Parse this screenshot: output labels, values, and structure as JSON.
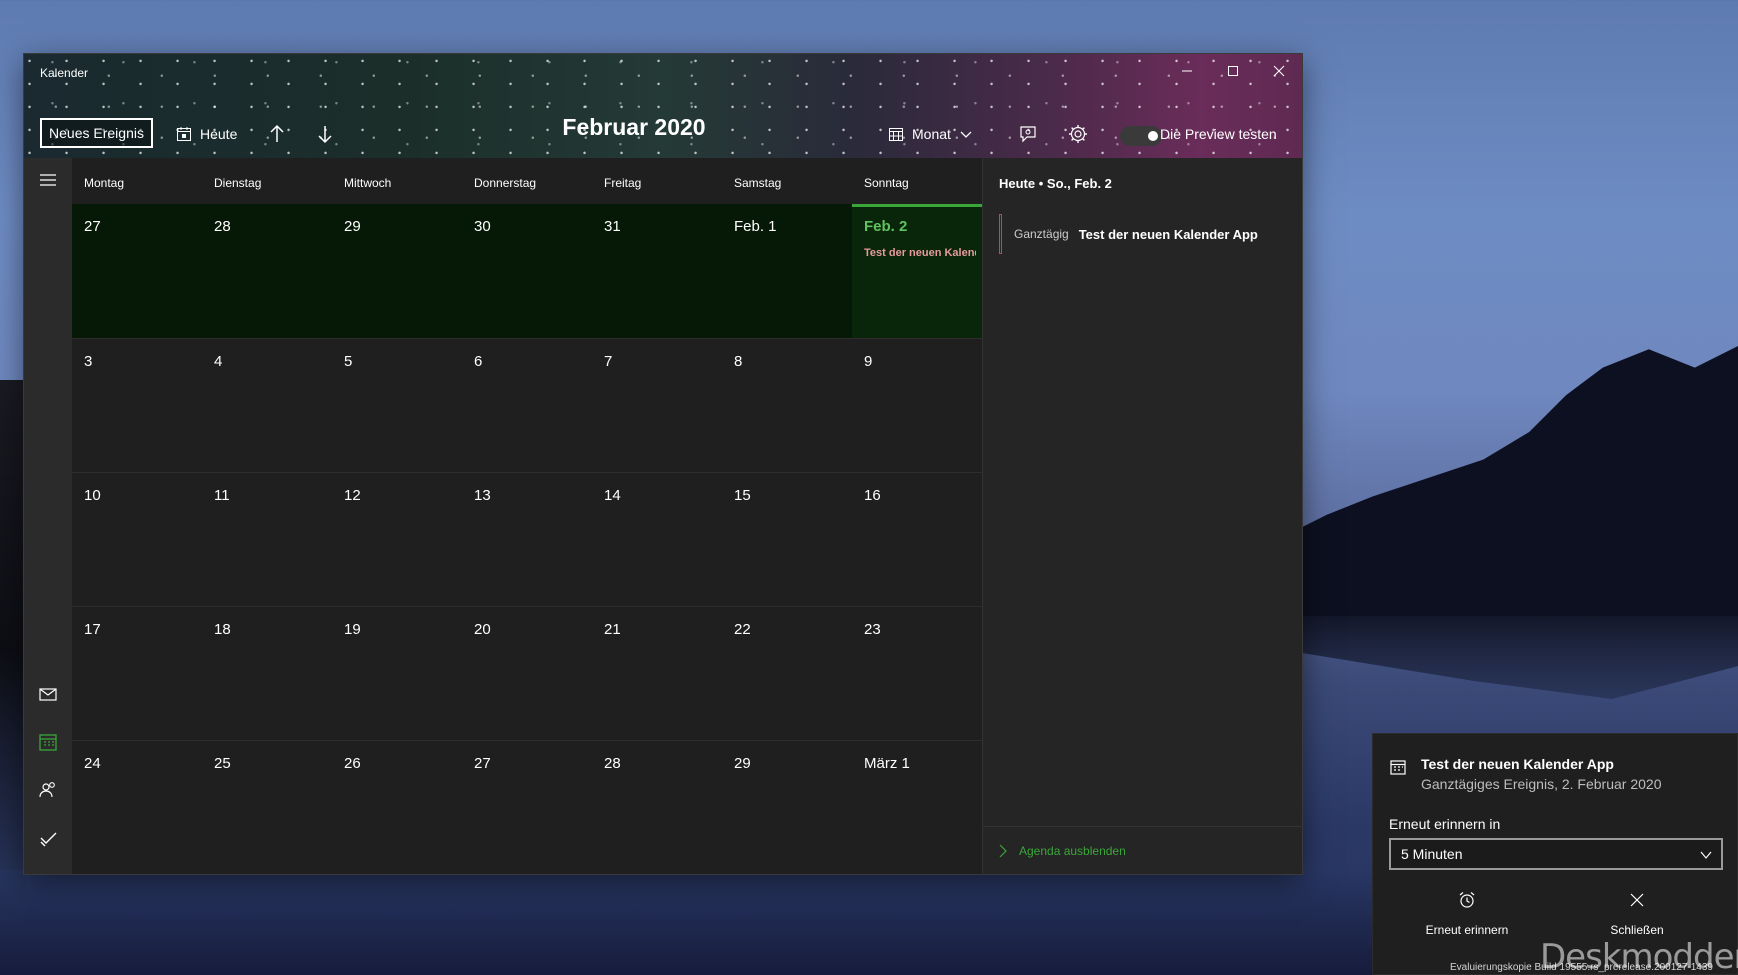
{
  "window": {
    "title": "Kalender"
  },
  "toolbar": {
    "new_event": "Neues Ereignis",
    "today": "Heute",
    "month_title": "Februar 2020",
    "view": "Monat",
    "preview_label": "Die Preview testen"
  },
  "day_headers": [
    "Montag",
    "Dienstag",
    "Mittwoch",
    "Donnerstag",
    "Freitag",
    "Samstag",
    "Sonntag"
  ],
  "weeks": [
    [
      "27",
      "28",
      "29",
      "30",
      "31",
      "Feb. 1",
      "Feb. 2"
    ],
    [
      "3",
      "4",
      "5",
      "6",
      "7",
      "8",
      "9"
    ],
    [
      "10",
      "11",
      "12",
      "13",
      "14",
      "15",
      "16"
    ],
    [
      "17",
      "18",
      "19",
      "20",
      "21",
      "22",
      "23"
    ],
    [
      "24",
      "25",
      "26",
      "27",
      "28",
      "29",
      "März 1"
    ]
  ],
  "today_event": "Test der neuen Kalender App",
  "agenda": {
    "header": "Heute • So., Feb. 2",
    "event_time": "Ganztägig",
    "event_title": "Test der neuen Kalender App",
    "hide_label": "Agenda ausblenden"
  },
  "toast": {
    "title": "Test der neuen Kalender App",
    "subtitle": "Ganztägiges Ereignis, 2. Februar 2020",
    "snooze_label": "Erneut erinnern in",
    "snooze_value": "5 Minuten",
    "snooze_button": "Erneut erinnern",
    "close_button": "Schließen"
  },
  "watermark": "Deskmodder.de",
  "build_info": "Evaluierungskopie Build 19555.rs_prerelease.200127-1439"
}
